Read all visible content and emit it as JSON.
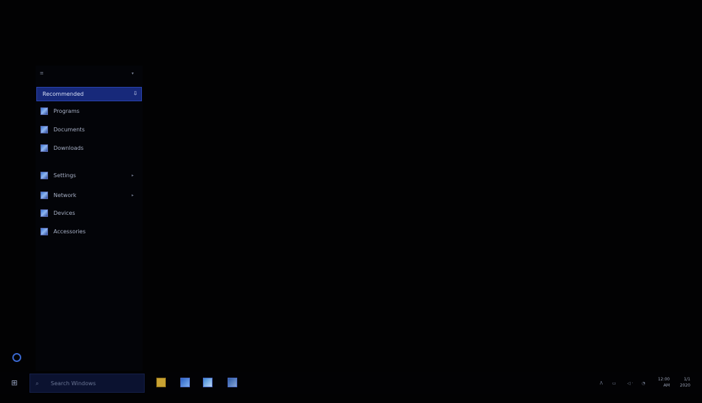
{
  "start_menu": {
    "header_label": "≡",
    "header_arrow": "▾",
    "selected_item": {
      "label": "Recommended",
      "pin": "⇩"
    },
    "items": [
      {
        "label": "Programs",
        "arrow": ""
      },
      {
        "label": "Documents",
        "arrow": ""
      },
      {
        "label": "Downloads",
        "arrow": ""
      },
      {
        "label": "Settings",
        "arrow": "▸"
      },
      {
        "label": "Network",
        "arrow": "▸"
      },
      {
        "label": "Devices",
        "arrow": ""
      },
      {
        "label": "Accessories",
        "arrow": ""
      }
    ]
  },
  "taskbar": {
    "start_glyph": "⊞",
    "search_icon": "⌕",
    "search_placeholder": "Search Windows",
    "tray": [
      "ᐱ",
      "▭",
      "◁ ‧",
      "◔"
    ],
    "clock": {
      "line1": "12:00",
      "line2": "AM"
    },
    "date": {
      "line1": "1/1",
      "line2": "2020"
    }
  }
}
